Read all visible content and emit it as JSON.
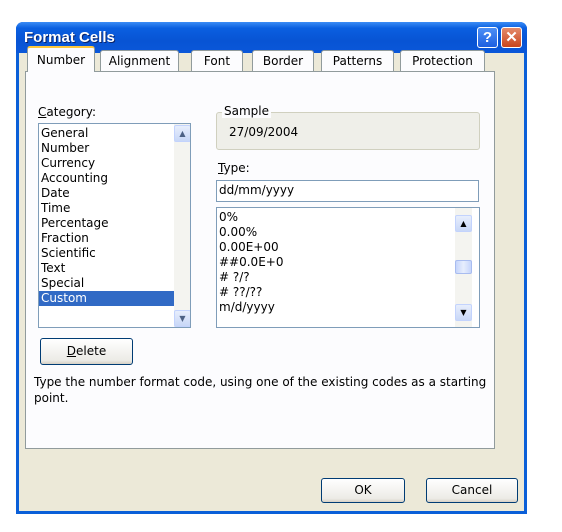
{
  "window": {
    "title": "Format Cells",
    "help_glyph": "?",
    "close_glyph": "✕"
  },
  "tabs": [
    {
      "label": "Number",
      "active": true
    },
    {
      "label": "Alignment",
      "active": false
    },
    {
      "label": "Font",
      "active": false
    },
    {
      "label": "Border",
      "active": false
    },
    {
      "label": "Patterns",
      "active": false
    },
    {
      "label": "Protection",
      "active": false
    }
  ],
  "category": {
    "label_accel": "C",
    "label_rest": "ategory:",
    "items": [
      "General",
      "Number",
      "Currency",
      "Accounting",
      "Date",
      "Time",
      "Percentage",
      "Fraction",
      "Scientific",
      "Text",
      "Special",
      "Custom"
    ],
    "selected": "Custom"
  },
  "sample": {
    "label": "Sample",
    "value": "27/09/2004"
  },
  "type": {
    "label_accel": "T",
    "label_rest": "ype:",
    "value": "dd/mm/yyyy",
    "list": [
      "0%",
      "0.00%",
      "0.00E+00",
      "##0.0E+0",
      "# ?/?",
      "# ??/??",
      "m/d/yyyy"
    ]
  },
  "delete_button": {
    "accel": "D",
    "rest": "elete"
  },
  "description": "Type the number format code, using one of the existing codes as a starting point.",
  "footer": {
    "ok": "OK",
    "cancel": "Cancel"
  },
  "icons": {
    "scroll_up": "up-arrow-icon",
    "scroll_down": "down-arrow-icon"
  }
}
